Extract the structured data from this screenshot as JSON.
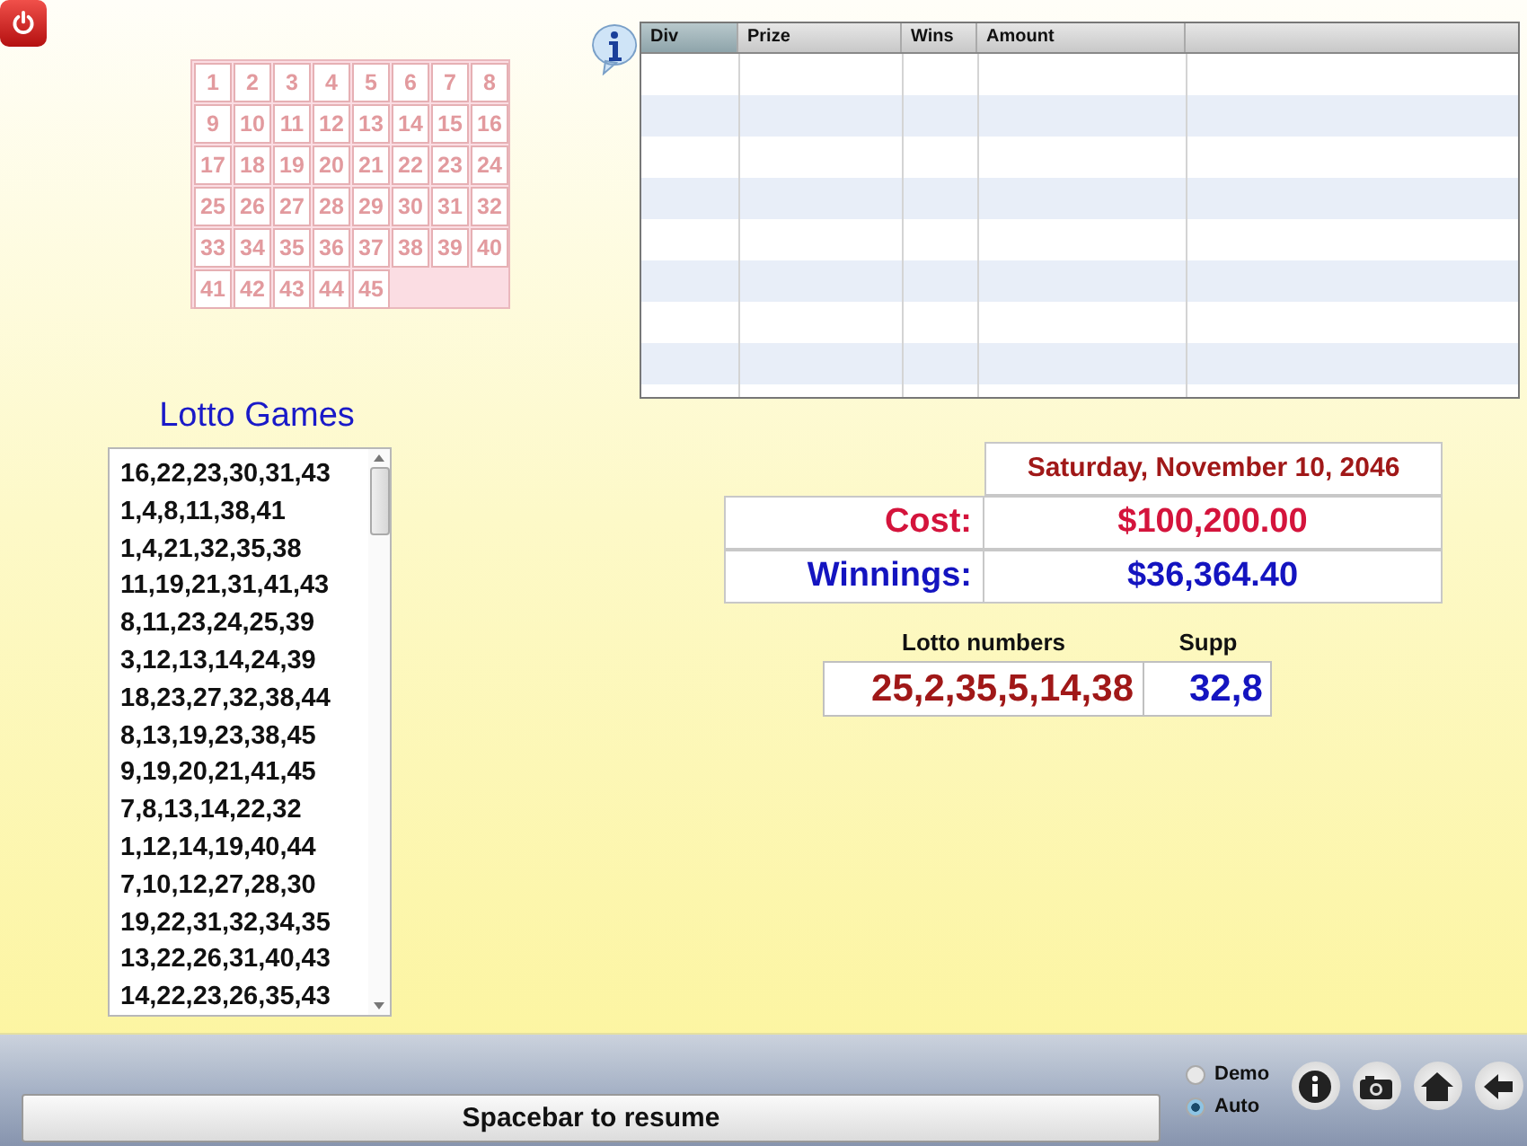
{
  "number_grid": [
    "1",
    "2",
    "3",
    "4",
    "5",
    "6",
    "7",
    "8",
    "9",
    "10",
    "11",
    "12",
    "13",
    "14",
    "15",
    "16",
    "17",
    "18",
    "19",
    "20",
    "21",
    "22",
    "23",
    "24",
    "25",
    "26",
    "27",
    "28",
    "29",
    "30",
    "31",
    "32",
    "33",
    "34",
    "35",
    "36",
    "37",
    "38",
    "39",
    "40",
    "41",
    "42",
    "43",
    "44",
    "45"
  ],
  "prize_table": {
    "columns": [
      {
        "label": "Div",
        "selected": true
      },
      {
        "label": "Prize",
        "selected": false
      },
      {
        "label": "Wins",
        "selected": false
      },
      {
        "label": "Amount",
        "selected": false
      }
    ]
  },
  "games": {
    "title": "Lotto Games",
    "items": [
      "16,22,23,30,31,43",
      "1,4,8,11,38,41",
      "1,4,21,32,35,38",
      "11,19,21,31,41,43",
      "8,11,23,24,25,39",
      "3,12,13,14,24,39",
      "18,23,27,32,38,44",
      "8,13,19,23,38,45",
      "9,19,20,21,41,45",
      "7,8,13,14,22,32",
      "1,12,14,19,40,44",
      "7,10,12,27,28,30",
      "19,22,31,32,34,35",
      "13,22,26,31,40,43",
      "14,22,23,26,35,43"
    ]
  },
  "summary": {
    "date": "Saturday, November 10, 2046",
    "rows": [
      {
        "kind": "cost",
        "label": "Cost:",
        "value": "$100,200.00"
      },
      {
        "kind": "winnings",
        "label": "Winnings:",
        "value": "$36,364.40"
      }
    ]
  },
  "draw": {
    "numbers_label": "Lotto numbers",
    "supp_label": "Supp",
    "numbers": "25,2,35,5,14,38",
    "supp": "32,8"
  },
  "mode": [
    {
      "label": "Demo",
      "selected": false
    },
    {
      "label": "Auto",
      "selected": true
    }
  ],
  "resume_button": "Spacebar to resume"
}
